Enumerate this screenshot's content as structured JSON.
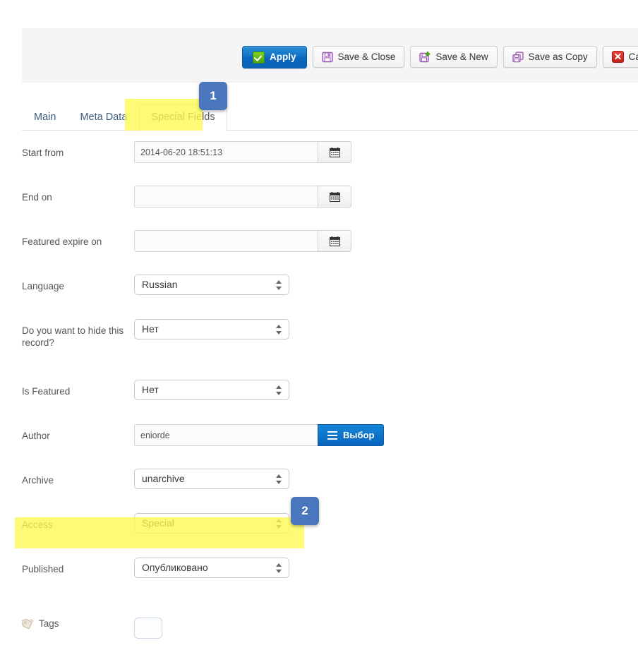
{
  "toolbar": {
    "buttons": [
      {
        "label": "Apply",
        "icon": "green-check-icon",
        "style": "primary"
      },
      {
        "label": "Save & Close",
        "icon": "floppy-disk-icon",
        "style": "default"
      },
      {
        "label": "Save & New",
        "icon": "floppy-disk-plus-icon",
        "style": "default"
      },
      {
        "label": "Save as Copy",
        "icon": "floppy-disk-copy-icon",
        "style": "default"
      },
      {
        "label": "Cancel",
        "icon": "red-x-icon",
        "style": "default"
      }
    ]
  },
  "tabs": [
    {
      "label": "Main",
      "active": false
    },
    {
      "label": "Meta Data",
      "active": false
    },
    {
      "label": "Special Fields",
      "active": true
    }
  ],
  "form": {
    "start_from": {
      "label": "Start from",
      "value": "2014-06-20 18:51:13",
      "placeholder": ""
    },
    "end_on": {
      "label": "End on",
      "value": "",
      "placeholder": ""
    },
    "featured_expire": {
      "label": "Featured expire on",
      "value": "",
      "placeholder": ""
    },
    "language": {
      "label": "Language",
      "value": "Russian"
    },
    "hide_record": {
      "label": "Do you want to hide this record?",
      "value": "Нет"
    },
    "is_featured": {
      "label": "Is Featured",
      "value": "Нет"
    },
    "author": {
      "label": "Author",
      "value": "eniorde",
      "button_label": "Выбор",
      "button_icon": "list-icon"
    },
    "archive": {
      "label": "Archive",
      "value": "unarchive"
    },
    "access": {
      "label": "Access",
      "value": "Special"
    },
    "published": {
      "label": "Published",
      "value": "Опубликовано"
    },
    "tags": {
      "label": "Tags",
      "icon": "tag-icon",
      "value": ""
    }
  },
  "annotations": {
    "badge_1": "1",
    "badge_2": "2",
    "highlight_color": "#fdf84e",
    "badge_color": "#4a76bd"
  }
}
